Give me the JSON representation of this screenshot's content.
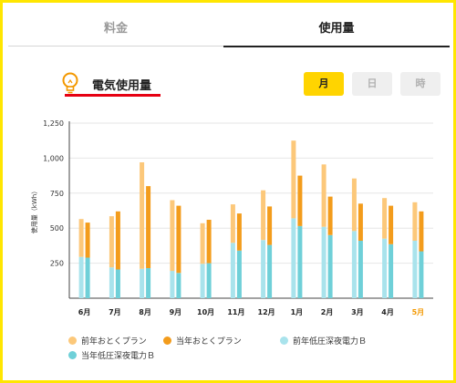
{
  "tabs": [
    {
      "label": "料金",
      "active": false
    },
    {
      "label": "使用量",
      "active": true
    }
  ],
  "heading": {
    "title": "電気使用量",
    "icon": "lightbulb-icon",
    "underline_color": "#e60012"
  },
  "period_buttons": [
    {
      "label": "月",
      "selected": true
    },
    {
      "label": "日",
      "selected": false
    },
    {
      "label": "時",
      "selected": false
    }
  ],
  "colors": {
    "accent": "#ffd400",
    "highlight_month": "#f39800"
  },
  "chart_data": {
    "type": "bar",
    "ylabel": "使用量（kWh）",
    "ylim": [
      0,
      1250
    ],
    "yticks": [
      "250",
      "500",
      "750",
      "1,000",
      "1,250"
    ],
    "ytick_values": [
      250,
      500,
      750,
      1000,
      1250
    ],
    "categories": [
      "6月",
      "7月",
      "8月",
      "9月",
      "10月",
      "11月",
      "12月",
      "1月",
      "2月",
      "3月",
      "4月",
      "5月"
    ],
    "highlight_category": "5月",
    "grid": true,
    "stacks": [
      {
        "name": "前年",
        "segments": [
          "前年低圧深夜電力Ｂ",
          "前年おとくプラン"
        ]
      },
      {
        "name": "当年",
        "segments": [
          "当年低圧深夜電力Ｂ",
          "当年おとくプラン"
        ]
      }
    ],
    "series": [
      {
        "name": "前年おとくプラン",
        "color": "#fcc87a",
        "values": [
          270,
          365,
          760,
          505,
          290,
          275,
          355,
          555,
          445,
          375,
          290,
          275
        ]
      },
      {
        "name": "当年おとくプラン",
        "color": "#f39c1c",
        "values": [
          250,
          415,
          585,
          480,
          310,
          265,
          275,
          360,
          275,
          265,
          275,
          285
        ]
      },
      {
        "name": "前年低圧深夜電力Ｂ",
        "color": "#a9e3ec",
        "values": [
          295,
          220,
          210,
          195,
          245,
          395,
          415,
          570,
          510,
          480,
          425,
          410
        ]
      },
      {
        "name": "当年低圧深夜電力Ｂ",
        "color": "#6fd0d8",
        "values": [
          290,
          205,
          215,
          180,
          250,
          340,
          380,
          515,
          450,
          410,
          385,
          335
        ]
      }
    ],
    "legend": [
      {
        "label": "前年おとくプラン",
        "color": "#fcc87a"
      },
      {
        "label": "当年おとくプラン",
        "color": "#f39c1c"
      },
      {
        "label": "前年低圧深夜電力Ｂ",
        "color": "#a9e3ec"
      },
      {
        "label": "当年低圧深夜電力Ｂ",
        "color": "#6fd0d8"
      }
    ]
  }
}
